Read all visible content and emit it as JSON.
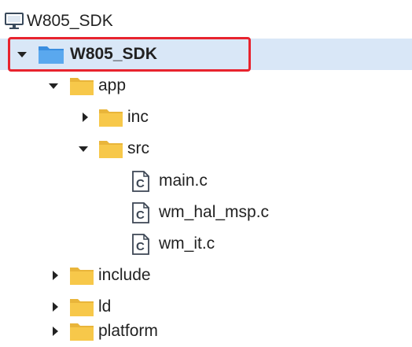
{
  "tree": {
    "root": {
      "label": "W805_SDK",
      "icon": "computer-icon"
    },
    "project": {
      "label": "W805_SDK",
      "icon": "blue-folder-icon",
      "expanded": true,
      "selected": true
    },
    "app": {
      "label": "app",
      "icon": "folder-icon",
      "expanded": true
    },
    "inc": {
      "label": "inc",
      "icon": "folder-icon",
      "expanded": false
    },
    "src": {
      "label": "src",
      "icon": "folder-icon",
      "expanded": true
    },
    "files": [
      {
        "label": "main.c",
        "icon": "c-file-icon"
      },
      {
        "label": "wm_hal_msp.c",
        "icon": "c-file-icon"
      },
      {
        "label": "wm_it.c",
        "icon": "c-file-icon"
      }
    ],
    "include": {
      "label": "include",
      "icon": "folder-icon",
      "expanded": false
    },
    "ld": {
      "label": "ld",
      "icon": "folder-icon",
      "expanded": false
    },
    "platform": {
      "label": "platform",
      "icon": "folder-icon",
      "expanded": false
    }
  },
  "colors": {
    "folder": "#f7c84a",
    "folder_dark": "#e9b53a",
    "blue_folder": "#4d9de8",
    "selection_bg": "#d9e7f7",
    "highlight_outline": "#e8232e"
  }
}
